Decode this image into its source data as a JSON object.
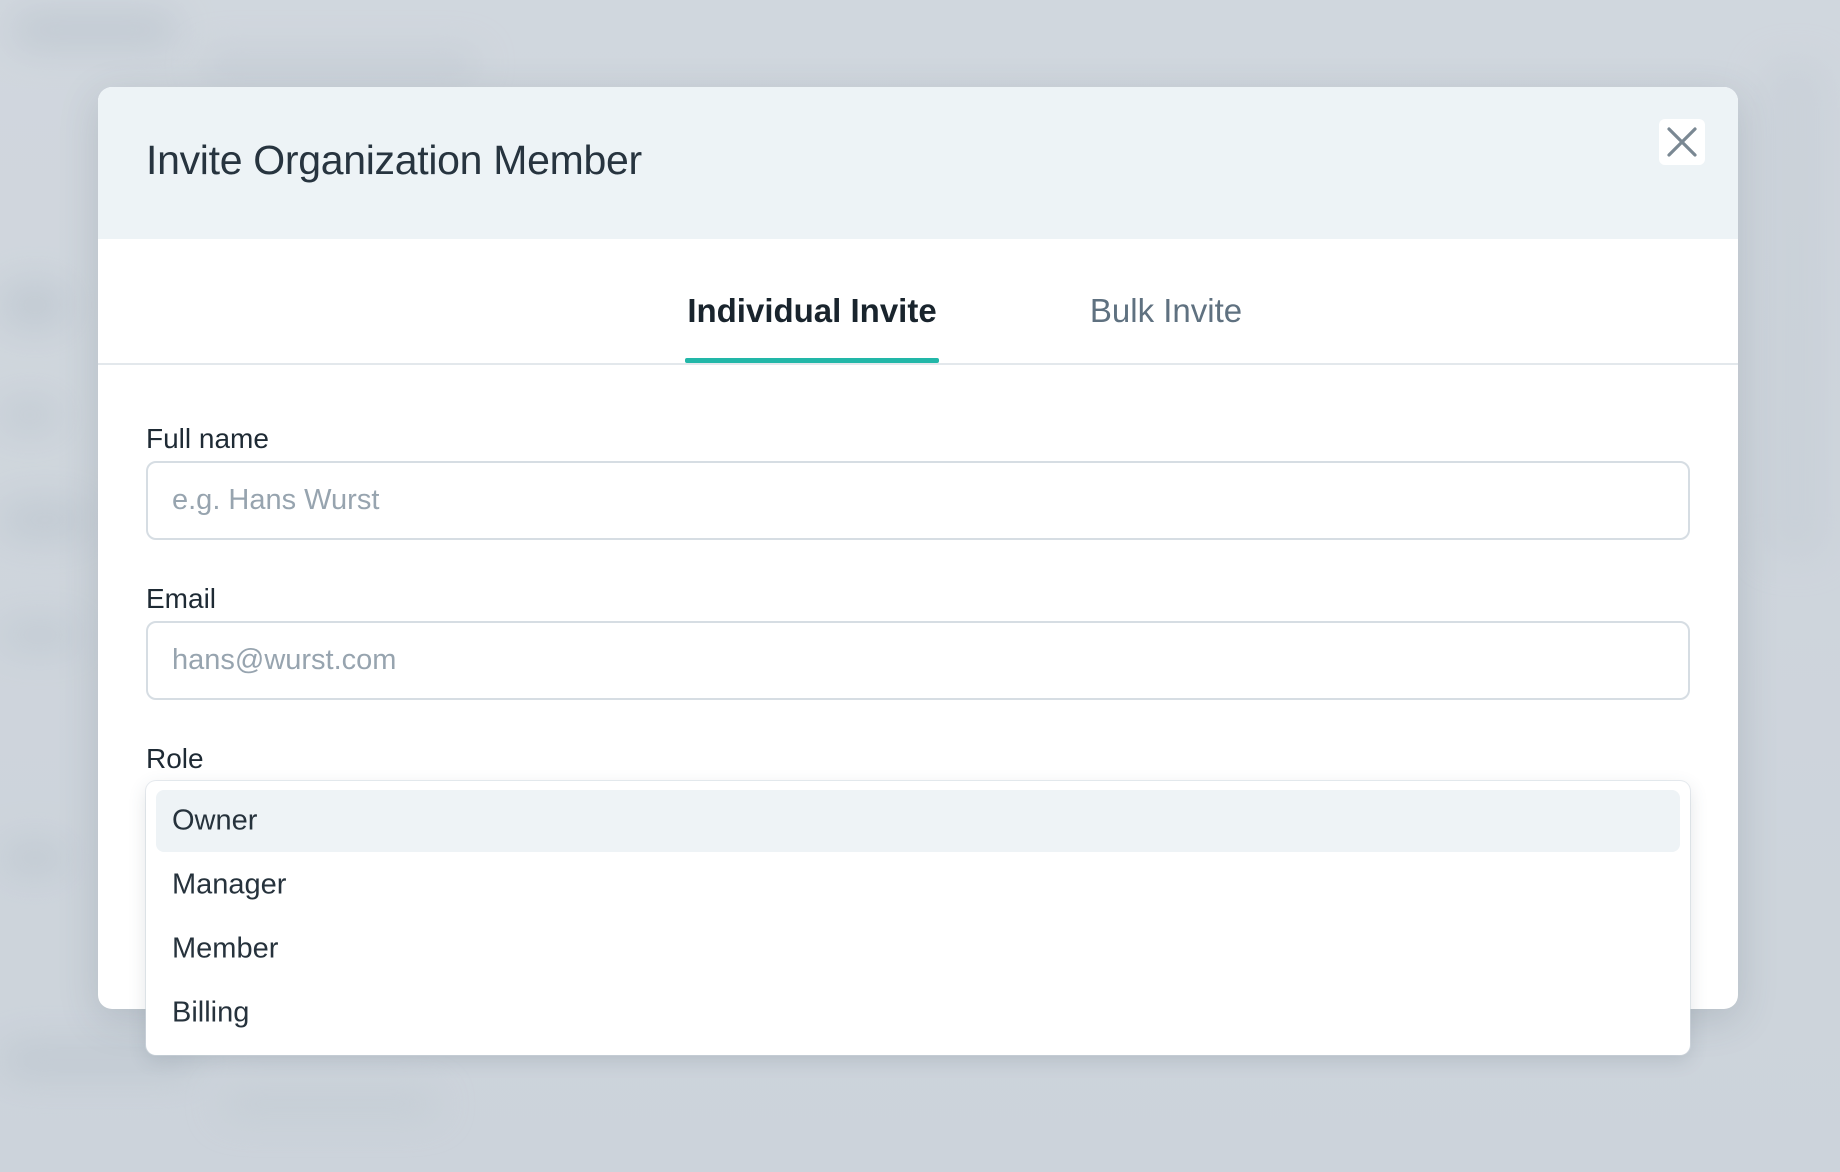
{
  "modal": {
    "title": "Invite Organization Member",
    "close_icon": "close-icon"
  },
  "tabs": [
    {
      "label": "Individual Invite",
      "active": true
    },
    {
      "label": "Bulk Invite",
      "active": false
    }
  ],
  "form": {
    "full_name": {
      "label": "Full name",
      "value": "",
      "placeholder": "e.g. Hans Wurst"
    },
    "email": {
      "label": "Email",
      "value": "",
      "placeholder": "hans@wurst.com"
    },
    "role": {
      "label": "Role",
      "options": [
        "Owner",
        "Manager",
        "Member",
        "Billing"
      ],
      "highlighted": "Owner"
    }
  },
  "colors": {
    "accent": "#22b7a8",
    "header_bg": "#edf3f6",
    "backdrop": "#cdd5dc"
  }
}
